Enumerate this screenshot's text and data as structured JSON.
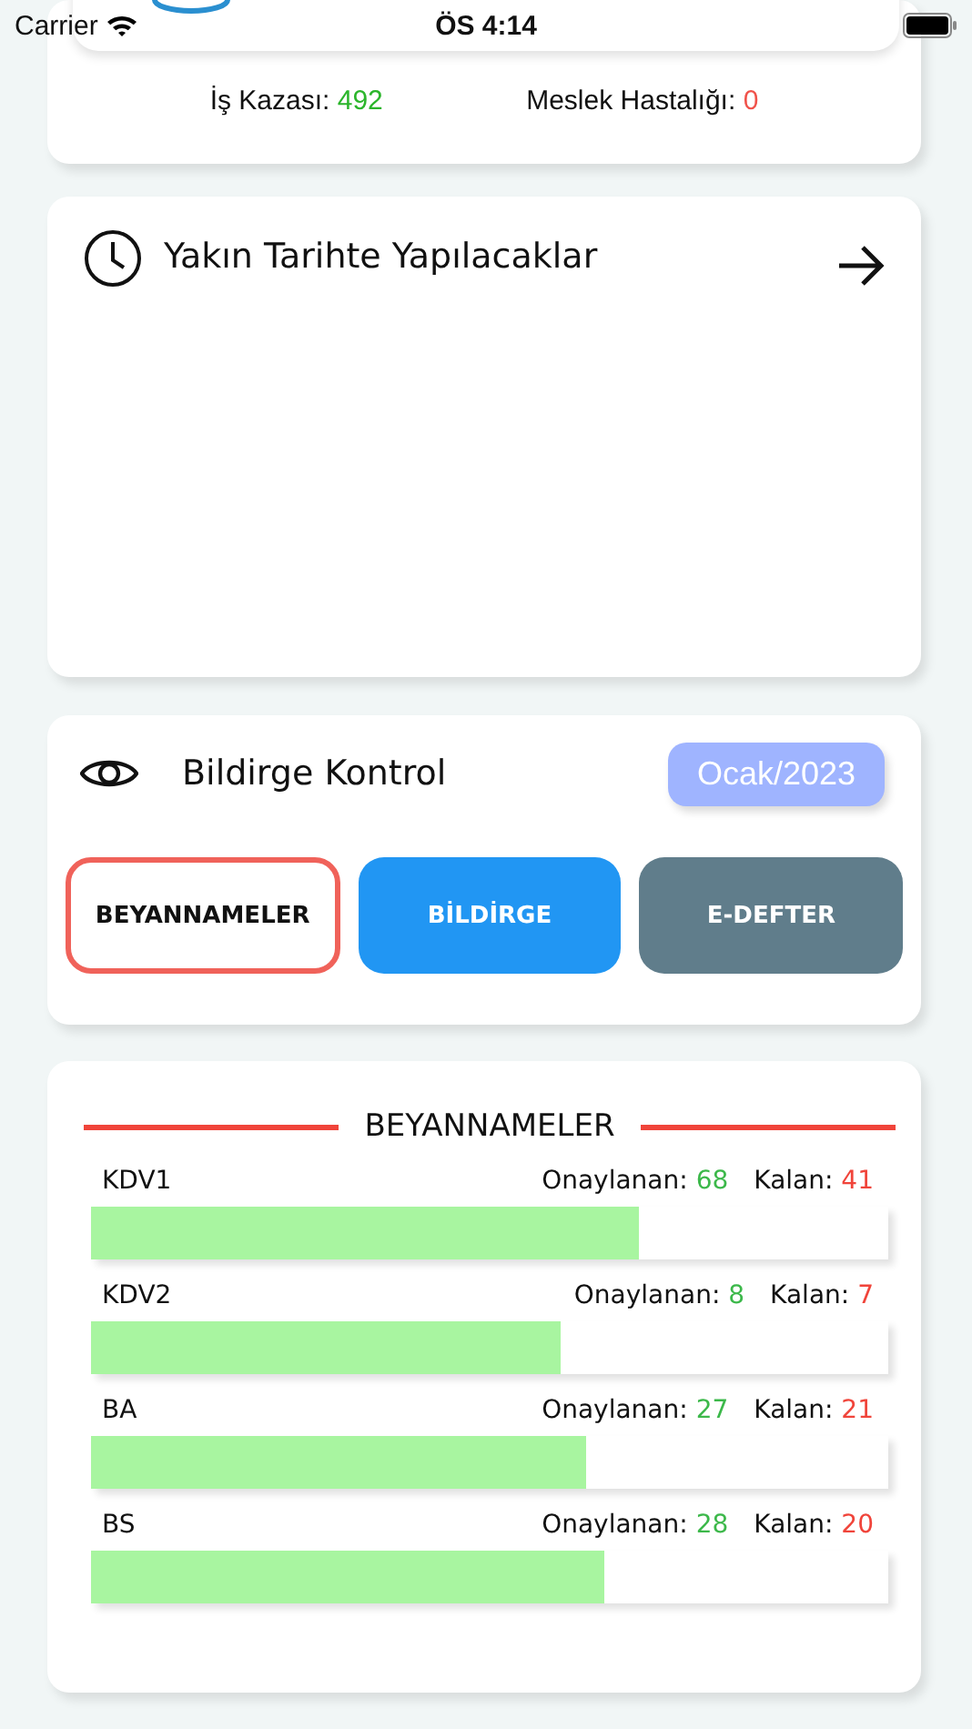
{
  "status_bar": {
    "carrier": "Carrier",
    "time": "ÖS 4:14"
  },
  "summary": {
    "items": [
      {
        "label": "İş Kazası:",
        "value": "492",
        "color": "#2bb52b"
      },
      {
        "label": "Meslek Hastalığı:",
        "value": "0",
        "color": "#f0524a"
      }
    ]
  },
  "upcoming": {
    "title": "Yakın Tarihte Yapılacaklar"
  },
  "control": {
    "title": "Bildirge Kontrol",
    "period": "Ocak/2023",
    "tabs": [
      {
        "label": "BEYANNAMELER",
        "selected": true,
        "color": "#f0625a"
      },
      {
        "label": "BİLDİRGE",
        "selected": false,
        "color": "#2196f3"
      },
      {
        "label": "E-DEFTER",
        "selected": false,
        "color": "#607d8b"
      }
    ]
  },
  "declarations": {
    "title": "BEYANNAMELER",
    "rows": [
      {
        "name": "KDV1",
        "approved_label": "Onaylanan:",
        "approved": "68",
        "remaining_label": "Kalan:",
        "remaining": "41",
        "level": 0.687
      },
      {
        "name": "KDV2",
        "approved_label": "Onaylanan:",
        "approved": "8",
        "remaining_label": "Kalan:",
        "remaining": "7",
        "level": 0.588
      },
      {
        "name": "BA",
        "approved_label": "Onaylanan:",
        "approved": "27",
        "remaining_label": "Kalan:",
        "remaining": "21",
        "level": 0.62
      },
      {
        "name": "BS",
        "approved_label": "Onaylanan:",
        "approved": "28",
        "remaining_label": "Kalan:",
        "remaining": "20",
        "level": 0.643
      }
    ]
  }
}
